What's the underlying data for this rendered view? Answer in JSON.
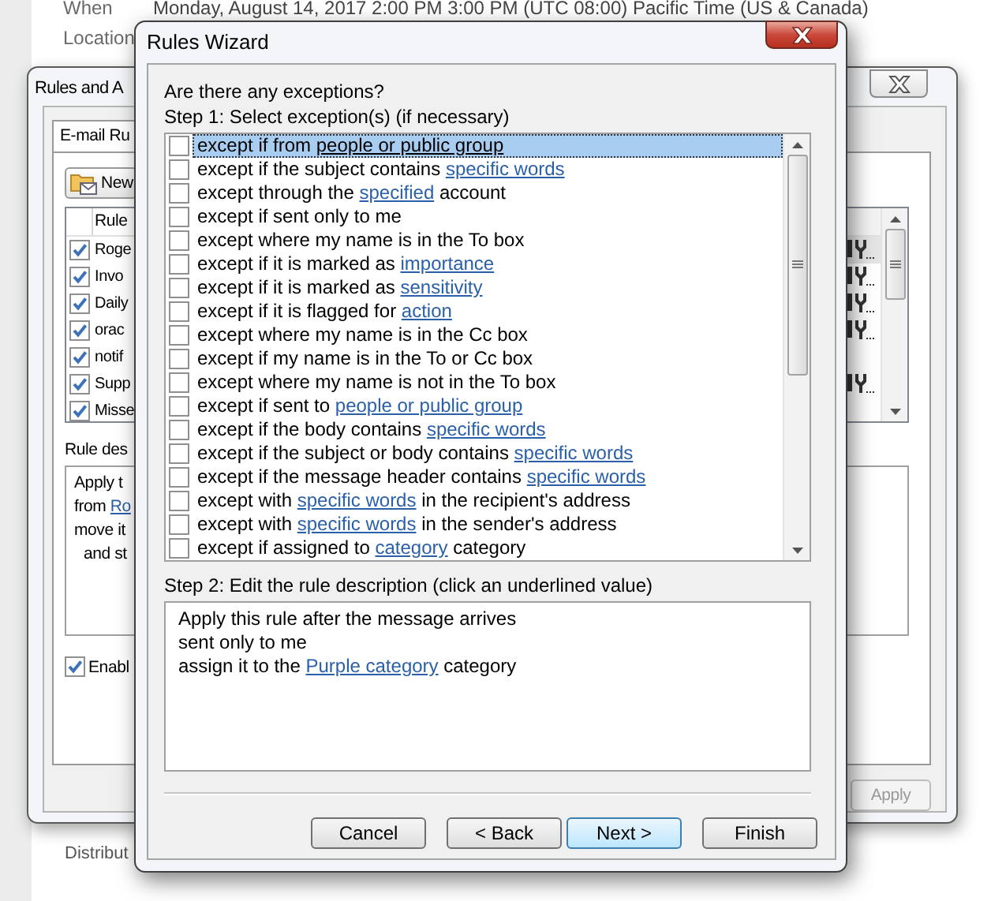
{
  "reading_pane": {
    "fields": [
      {
        "label": "When",
        "value": "Monday, August 14, 2017 2:00 PM 3:00 PM (UTC 08:00) Pacific Time (US & Canada)"
      },
      {
        "label": "Location"
      }
    ],
    "footer_text": "Distribut"
  },
  "rules_window": {
    "title": "Rules and A",
    "tab": "E-mail Ru",
    "new_button": "New",
    "column_header": "Rule",
    "rules": [
      {
        "name": "Roge",
        "checked": true,
        "selected": true,
        "action_icon": true
      },
      {
        "name": "Invo",
        "checked": true,
        "selected": false,
        "action_icon": true
      },
      {
        "name": "Daily",
        "checked": true,
        "selected": false,
        "action_icon": true
      },
      {
        "name": "orac",
        "checked": true,
        "selected": false,
        "action_icon": true
      },
      {
        "name": "notif",
        "checked": true,
        "selected": false,
        "action_icon": false
      },
      {
        "name": "Supp",
        "checked": true,
        "selected": false,
        "action_icon": true
      },
      {
        "name": "Misse",
        "checked": true,
        "selected": false,
        "action_icon": false
      }
    ],
    "description_label": "Rule des",
    "description": [
      {
        "indented": false,
        "parts": [
          {
            "kind": "text",
            "text": "Apply t"
          }
        ]
      },
      {
        "indented": false,
        "parts": [
          {
            "kind": "text",
            "text": "from"
          },
          {
            "kind": "link",
            "text": "Ro"
          }
        ]
      },
      {
        "indented": false,
        "parts": [
          {
            "kind": "text",
            "text": "move it"
          }
        ]
      },
      {
        "indented": true,
        "parts": [
          {
            "kind": "text",
            "text": "and st"
          }
        ]
      }
    ],
    "enable_checkbox": {
      "label": "Enabl",
      "checked": true
    },
    "apply_button": {
      "label": "Apply",
      "disabled": true
    }
  },
  "wizard": {
    "title": "Rules Wizard",
    "question": "Are there any exceptions?",
    "step1_label": "Step 1: Select exception(s) (if necessary)",
    "conditions": [
      {
        "checked": false,
        "selected": true,
        "parts": [
          {
            "kind": "text",
            "text": "except if from"
          },
          {
            "kind": "link",
            "text": "people or public group"
          }
        ]
      },
      {
        "checked": false,
        "selected": false,
        "parts": [
          {
            "kind": "text",
            "text": "except if the subject contains"
          },
          {
            "kind": "link",
            "text": "specific words"
          }
        ]
      },
      {
        "checked": false,
        "selected": false,
        "parts": [
          {
            "kind": "text",
            "text": "except through the"
          },
          {
            "kind": "link",
            "text": "specified"
          },
          {
            "kind": "text",
            "text": "account"
          }
        ]
      },
      {
        "checked": false,
        "selected": false,
        "parts": [
          {
            "kind": "text",
            "text": "except if sent only to me"
          }
        ]
      },
      {
        "checked": false,
        "selected": false,
        "parts": [
          {
            "kind": "text",
            "text": "except where my name is in the To box"
          }
        ]
      },
      {
        "checked": false,
        "selected": false,
        "parts": [
          {
            "kind": "text",
            "text": "except if it is marked as"
          },
          {
            "kind": "link",
            "text": "importance"
          }
        ]
      },
      {
        "checked": false,
        "selected": false,
        "parts": [
          {
            "kind": "text",
            "text": "except if it is marked as"
          },
          {
            "kind": "link",
            "text": "sensitivity"
          }
        ]
      },
      {
        "checked": false,
        "selected": false,
        "parts": [
          {
            "kind": "text",
            "text": "except if it is flagged for"
          },
          {
            "kind": "link",
            "text": "action"
          }
        ]
      },
      {
        "checked": false,
        "selected": false,
        "parts": [
          {
            "kind": "text",
            "text": "except where my name is in the Cc box"
          }
        ]
      },
      {
        "checked": false,
        "selected": false,
        "parts": [
          {
            "kind": "text",
            "text": "except if my name is in the To or Cc box"
          }
        ]
      },
      {
        "checked": false,
        "selected": false,
        "parts": [
          {
            "kind": "text",
            "text": "except where my name is not in the To box"
          }
        ]
      },
      {
        "checked": false,
        "selected": false,
        "parts": [
          {
            "kind": "text",
            "text": "except if sent to"
          },
          {
            "kind": "link",
            "text": "people or public group"
          }
        ]
      },
      {
        "checked": false,
        "selected": false,
        "parts": [
          {
            "kind": "text",
            "text": "except if the body contains"
          },
          {
            "kind": "link",
            "text": "specific words"
          }
        ]
      },
      {
        "checked": false,
        "selected": false,
        "parts": [
          {
            "kind": "text",
            "text": "except if the subject or body contains"
          },
          {
            "kind": "link",
            "text": "specific words"
          }
        ]
      },
      {
        "checked": false,
        "selected": false,
        "parts": [
          {
            "kind": "text",
            "text": "except if the message header contains"
          },
          {
            "kind": "link",
            "text": "specific words"
          }
        ]
      },
      {
        "checked": false,
        "selected": false,
        "parts": [
          {
            "kind": "text",
            "text": "except with"
          },
          {
            "kind": "link",
            "text": "specific words"
          },
          {
            "kind": "text",
            "text": "in the recipient's address"
          }
        ]
      },
      {
        "checked": false,
        "selected": false,
        "parts": [
          {
            "kind": "text",
            "text": "except with"
          },
          {
            "kind": "link",
            "text": "specific words"
          },
          {
            "kind": "text",
            "text": "in the sender's address"
          }
        ]
      },
      {
        "checked": false,
        "selected": false,
        "parts": [
          {
            "kind": "text",
            "text": "except if assigned to"
          },
          {
            "kind": "link",
            "text": "category"
          },
          {
            "kind": "text",
            "text": "category"
          }
        ]
      }
    ],
    "step2_label": "Step 2: Edit the rule description (click an underlined value)",
    "description": [
      {
        "parts": [
          {
            "kind": "text",
            "text": "Apply this rule after the message arrives"
          }
        ]
      },
      {
        "parts": [
          {
            "kind": "text",
            "text": "sent only to me"
          }
        ]
      },
      {
        "parts": [
          {
            "kind": "text",
            "text": "assign it to the"
          },
          {
            "kind": "link",
            "text": "Purple category"
          },
          {
            "kind": "text",
            "text": "category"
          }
        ]
      }
    ],
    "buttons": [
      {
        "kind": "cancel",
        "label": "Cancel",
        "default": false
      },
      {
        "kind": "back",
        "label": "< Back",
        "default": false
      },
      {
        "kind": "next",
        "label": "Next >",
        "default": true
      },
      {
        "kind": "finish",
        "label": "Finish",
        "default": false
      }
    ]
  }
}
